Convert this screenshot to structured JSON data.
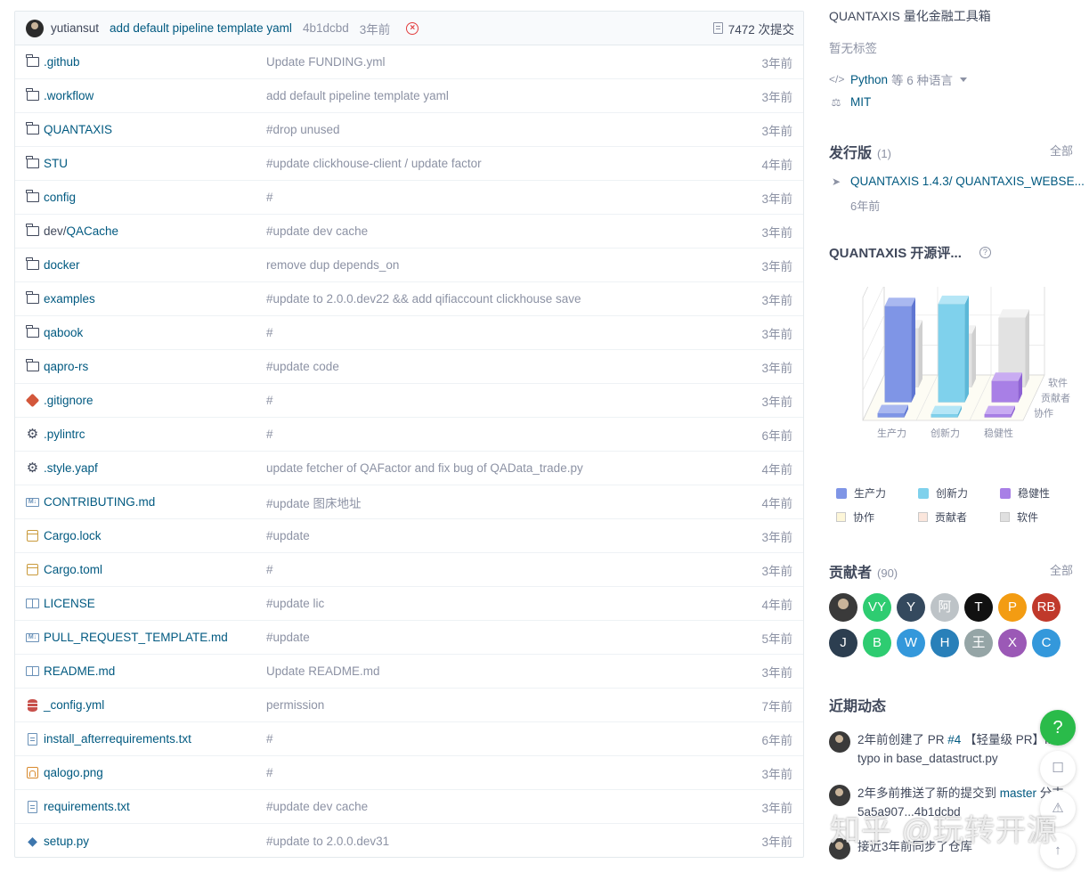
{
  "commit": {
    "author": "yutiansut",
    "message": "add default pipeline template yaml",
    "hash": "4b1dcbd",
    "time": "3年前",
    "count": "7472 次提交"
  },
  "files": [
    {
      "icon": "folder",
      "name": ".github",
      "message": "Update FUNDING.yml",
      "time": "3年前"
    },
    {
      "icon": "folder",
      "name": ".workflow",
      "message": "add default pipeline template yaml",
      "time": "3年前"
    },
    {
      "icon": "folder",
      "name": "QUANTAXIS",
      "message": "#drop unused",
      "time": "3年前"
    },
    {
      "icon": "folder",
      "name": "STU",
      "message": "#update clickhouse-client / update factor",
      "time": "4年前"
    },
    {
      "icon": "folder",
      "name": "config",
      "message": "#",
      "time": "3年前"
    },
    {
      "icon": "folder",
      "name_prefix": "dev/",
      "name": "QACache",
      "message": "#update dev cache",
      "time": "3年前"
    },
    {
      "icon": "folder",
      "name": "docker",
      "message": "remove dup depends_on",
      "time": "3年前"
    },
    {
      "icon": "folder",
      "name": "examples",
      "message": "#update to 2.0.0.dev22 && add qifiaccount clickhouse save",
      "time": "3年前"
    },
    {
      "icon": "folder",
      "name": "qabook",
      "message": "#",
      "time": "3年前"
    },
    {
      "icon": "folder",
      "name": "qapro-rs",
      "message": "#update code",
      "time": "3年前"
    },
    {
      "icon": "git",
      "name": ".gitignore",
      "message": "#",
      "time": "3年前"
    },
    {
      "icon": "gear",
      "name": ".pylintrc",
      "message": "#",
      "time": "6年前"
    },
    {
      "icon": "gear",
      "name": ".style.yapf",
      "message": "update fetcher of QAFactor and fix bug of QAData_trade.py",
      "time": "4年前"
    },
    {
      "icon": "md",
      "name": "CONTRIBUTING.md",
      "message": "#update 图床地址",
      "time": "4年前"
    },
    {
      "icon": "box",
      "name": "Cargo.lock",
      "message": "#update",
      "time": "3年前"
    },
    {
      "icon": "box",
      "name": "Cargo.toml",
      "message": "#",
      "time": "3年前"
    },
    {
      "icon": "book",
      "name": "LICENSE",
      "message": "#update lic",
      "time": "4年前"
    },
    {
      "icon": "md",
      "name": "PULL_REQUEST_TEMPLATE.md",
      "message": "#update",
      "time": "5年前"
    },
    {
      "icon": "book",
      "name": "README.md",
      "message": "Update README.md",
      "time": "3年前"
    },
    {
      "icon": "db",
      "name": "_config.yml",
      "message": "permission",
      "time": "7年前"
    },
    {
      "icon": "doc",
      "name": "install_afterrequirements.txt",
      "message": "#",
      "time": "6年前"
    },
    {
      "icon": "img",
      "name": "qalogo.png",
      "message": "#",
      "time": "3年前"
    },
    {
      "icon": "doc",
      "name": "requirements.txt",
      "message": "#update dev cache",
      "time": "3年前"
    },
    {
      "icon": "py",
      "name": "setup.py",
      "message": "#update to 2.0.0.dev31",
      "time": "3年前"
    }
  ],
  "sidebar": {
    "description": "QUANTAXIS 量化金融工具箱",
    "tags": "暂无标签",
    "language": "Python",
    "language_extra": "等 6 种语言",
    "license": "MIT",
    "releases_title": "发行版",
    "releases_count": "(1)",
    "all_label": "全部",
    "release_name": "QUANTAXIS 1.4.3/ QUANTAXIS_WEBSE...",
    "release_time": "6年前",
    "eval_title": "QUANTAXIS 开源评...",
    "contributors_title": "贡献者",
    "contributors_count": "(90)",
    "activity_title": "近期动态"
  },
  "chart_data": {
    "type": "bar",
    "categories": [
      "生产力",
      "创新力",
      "稳健性"
    ],
    "depth_labels": [
      "软件",
      "贡献者",
      "协作"
    ],
    "legend": [
      {
        "label": "生产力",
        "color": "#7f95e6"
      },
      {
        "label": "创新力",
        "color": "#7fd1ec"
      },
      {
        "label": "稳健性",
        "color": "#a87fe6"
      },
      {
        "label": "协作",
        "color": "#fdf6d8"
      },
      {
        "label": "贡献者",
        "color": "#fbe6dc"
      },
      {
        "label": "软件",
        "color": "#e0e0e0"
      }
    ],
    "series": [
      {
        "name": "软件",
        "values": [
          0.55,
          0.5,
          0.65
        ]
      },
      {
        "name": "贡献者",
        "values": [
          0.9,
          0.92,
          0.2
        ]
      },
      {
        "name": "协作",
        "values": [
          0.04,
          0.03,
          0.03
        ]
      }
    ]
  },
  "contributors": [
    {
      "label": "",
      "color": "#3a3a3a",
      "photo": true
    },
    {
      "label": "VY",
      "color": "#2ecc71"
    },
    {
      "label": "Y",
      "color": "#34495e"
    },
    {
      "label": "阿",
      "color": "#bdc3c7"
    },
    {
      "label": "T",
      "color": "#111111"
    },
    {
      "label": "P",
      "color": "#f39c12"
    },
    {
      "label": "RB",
      "color": "#c0392b"
    },
    {
      "label": "J",
      "color": "#2c3e50"
    },
    {
      "label": "B",
      "color": "#2ecc71"
    },
    {
      "label": "W",
      "color": "#3498db"
    },
    {
      "label": "H",
      "color": "#2980b9"
    },
    {
      "label": "王",
      "color": "#95a5a6"
    },
    {
      "label": "X",
      "color": "#9b59b6"
    },
    {
      "label": "C",
      "color": "#3498db"
    }
  ],
  "activity": [
    {
      "pre": "2年前创建了 PR ",
      "link": "#4",
      "post": " 【轻量级 PR】fix typo in base_datastruct.py"
    },
    {
      "pre": "2年多前推送了新的提交到 ",
      "link": "master",
      "post": " 分支，5a5a907...4b1dcbd"
    },
    {
      "pre": "接近3年前同步了仓库",
      "link": "",
      "post": ""
    }
  ],
  "floating": {
    "help": "?",
    "comment": "☐",
    "warn": "⚠",
    "top": "↑"
  },
  "watermark": "知乎 @玩转开源"
}
